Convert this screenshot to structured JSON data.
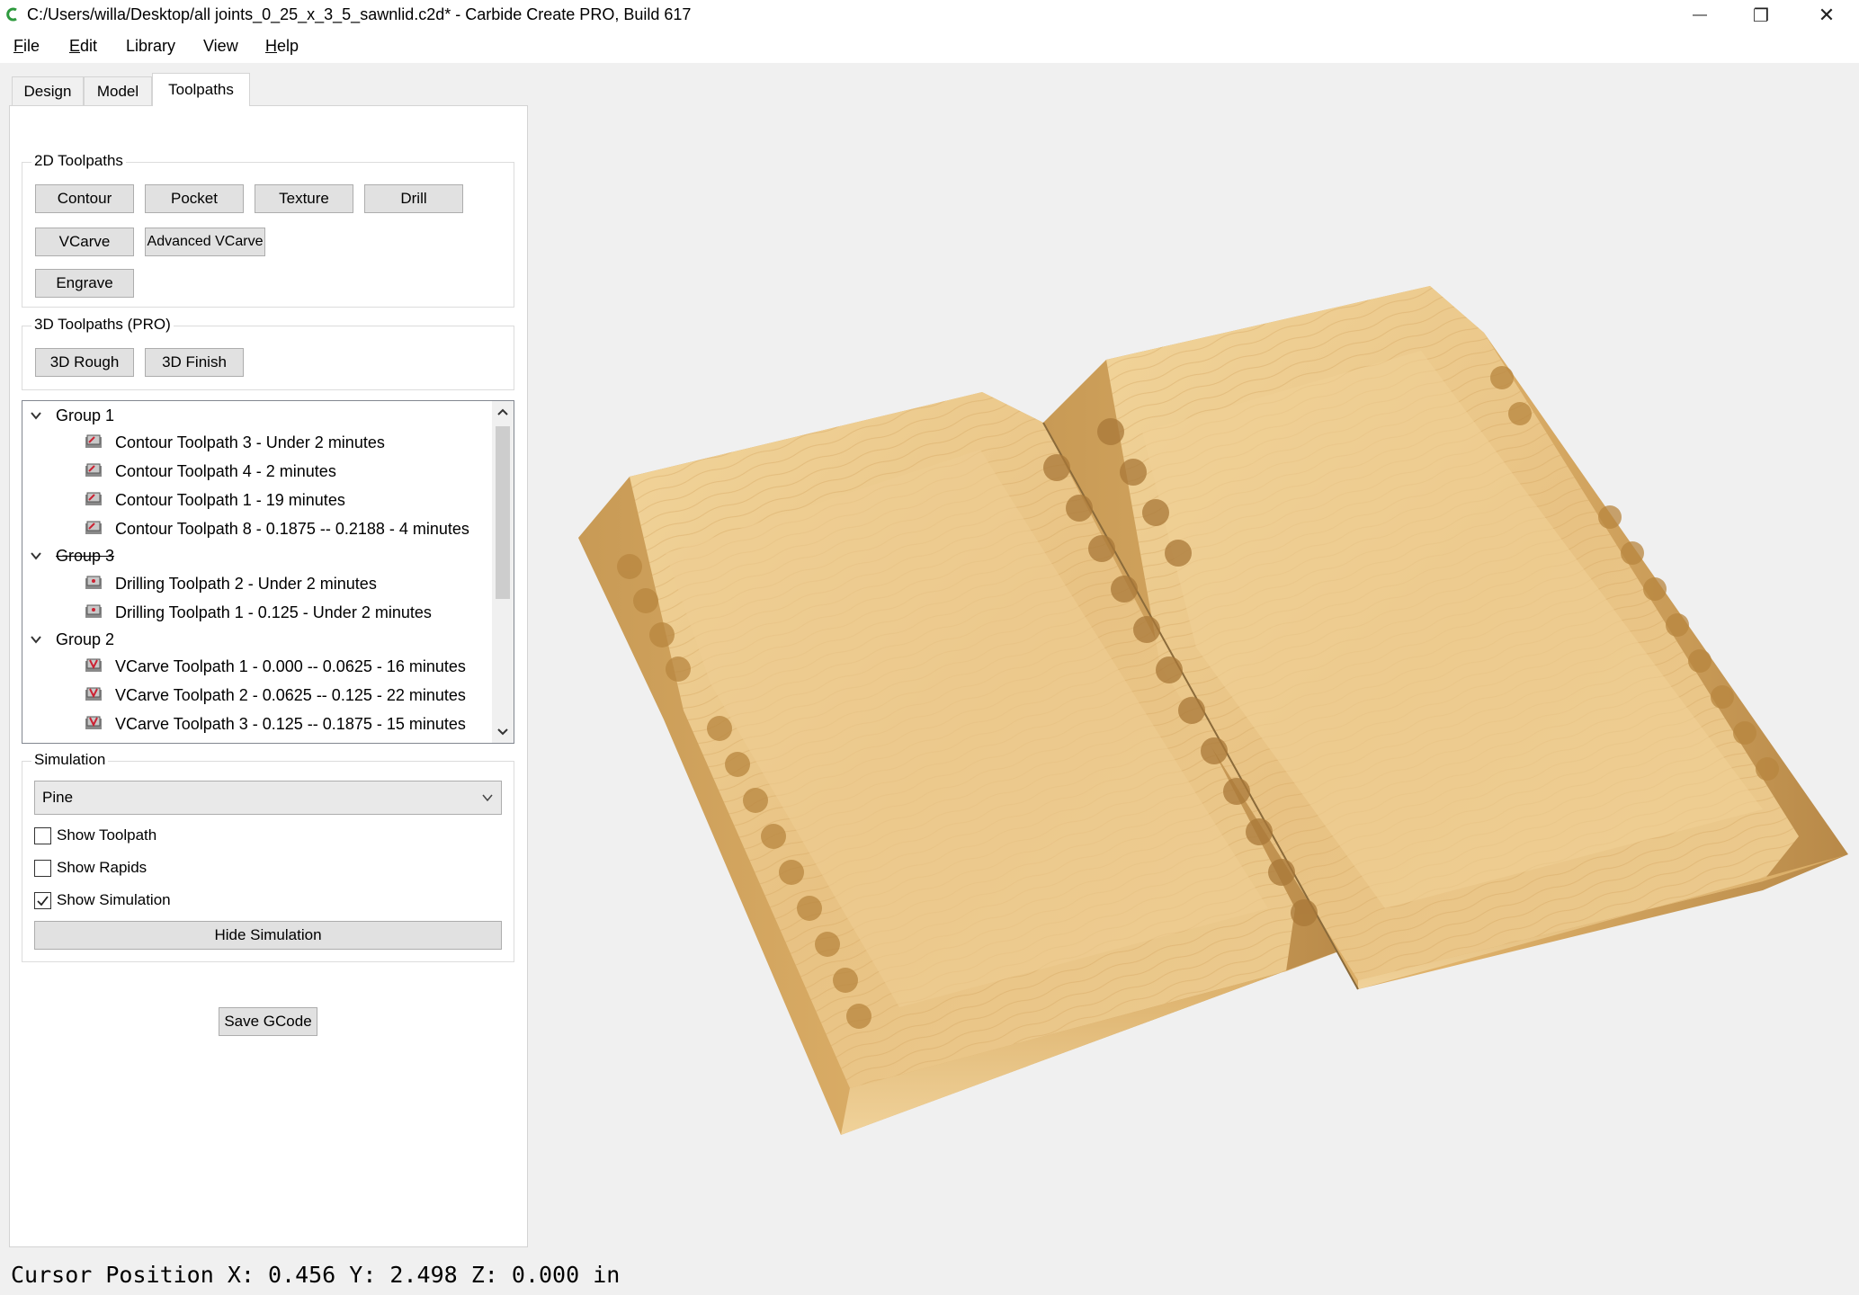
{
  "window": {
    "title": "C:/Users/willa/Desktop/all joints_0_25_x_3_5_sawnlid.c2d* - Carbide Create PRO, Build 617",
    "minimize_glyph": "—",
    "maximize_glyph": "❐",
    "close_glyph": "✕"
  },
  "menu": {
    "file": {
      "mnemonic": "F",
      "rest": "ile"
    },
    "edit": {
      "mnemonic": "E",
      "rest": "dit"
    },
    "library": "Library",
    "view": "View",
    "help": {
      "mnemonic": "H",
      "rest": "elp"
    }
  },
  "tabs": [
    "Design",
    "Model",
    "Toolpaths"
  ],
  "toolpaths_2d": {
    "title": "2D Toolpaths",
    "contour": "Contour",
    "pocket": "Pocket",
    "texture": "Texture",
    "drill": "Drill",
    "vcarve": "VCarve",
    "advanced_vcarve": "Advanced VCarve",
    "engrave": "Engrave"
  },
  "toolpaths_3d": {
    "title": "3D Toolpaths (PRO)",
    "rough": "3D Rough",
    "finish": "3D Finish"
  },
  "tree": {
    "group1": {
      "label": "Group 1",
      "items": [
        "Contour Toolpath 3 - Under 2 minutes",
        "Contour Toolpath 4 - 2 minutes",
        "Contour Toolpath 1 - 19 minutes",
        "Contour Toolpath 8 - 0.1875 -- 0.2188 - 4 minutes"
      ]
    },
    "group3": {
      "label": "Group 3",
      "items": [
        "Drilling Toolpath 2 - Under 2 minutes",
        "Drilling Toolpath 1 - 0.125 - Under 2 minutes"
      ]
    },
    "group2": {
      "label": "Group 2",
      "items": [
        "VCarve Toolpath 1 - 0.000 -- 0.0625 - 16 minutes",
        "VCarve Toolpath 2 - 0.0625 -- 0.125 - 22 minutes",
        "VCarve Toolpath 3 - 0.125 -- 0.1875 - 15 minutes"
      ]
    }
  },
  "simulation": {
    "title": "Simulation",
    "material": "Pine",
    "show_toolpath": "Show Toolpath",
    "show_rapids": "Show Rapids",
    "show_simulation": "Show Simulation",
    "hide_simulation": "Hide Simulation",
    "checked": {
      "show_toolpath": false,
      "show_rapids": false,
      "show_simulation": true
    }
  },
  "save_gcode": "Save GCode",
  "status": "Cursor Position X: 0.456 Y: 2.498 Z: 0.000 in",
  "colors": {
    "wood_light": "#e8c98a",
    "wood_mid": "#d9ab5e",
    "wood_dark": "#b8894a",
    "brand_green": "#2e9a3e"
  }
}
